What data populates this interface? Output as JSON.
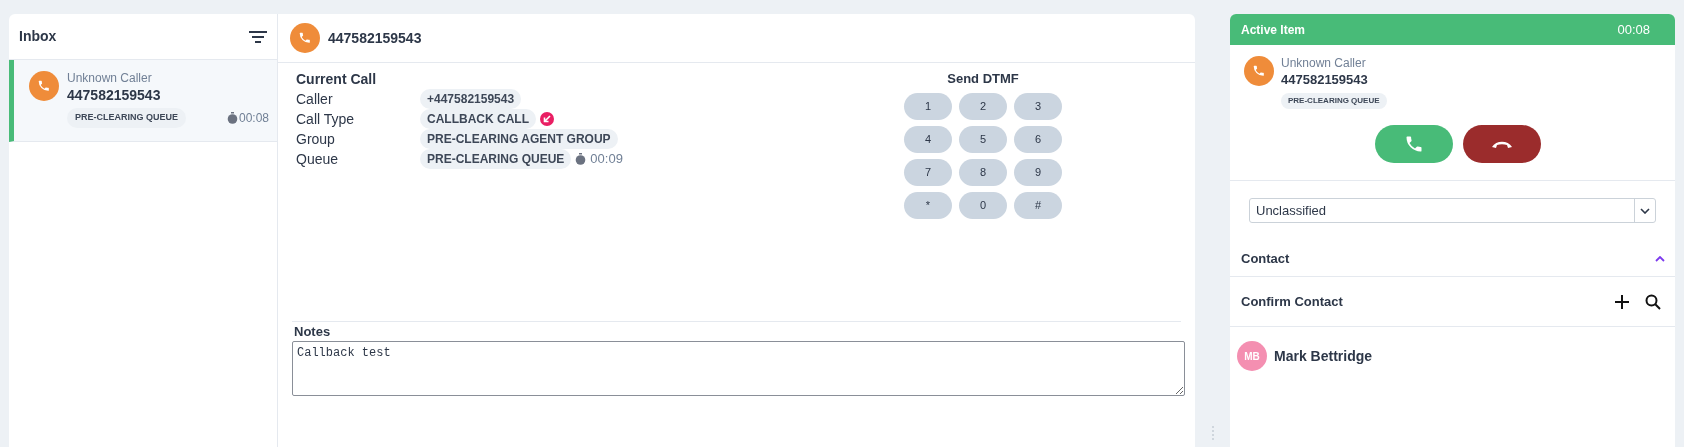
{
  "inbox": {
    "title": "Inbox",
    "items": [
      {
        "caller": "Unknown Caller",
        "number": "447582159543",
        "queue": "PRE-CLEARING QUEUE",
        "timer": "00:08",
        "selected": true
      }
    ]
  },
  "call": {
    "number": "447582159543",
    "section_title": "Current Call",
    "fields": [
      {
        "label": "Caller",
        "value": "+447582159543"
      },
      {
        "label": "Call Type",
        "value": "CALLBACK CALL",
        "kind": "callback"
      },
      {
        "label": "Group",
        "value": "PRE-CLEARING AGENT GROUP"
      },
      {
        "label": "Queue",
        "value": "PRE-CLEARING QUEUE",
        "kind": "timed",
        "timer": "00:09"
      }
    ],
    "dtmf": {
      "title": "Send DTMF",
      "keys": [
        "1",
        "2",
        "3",
        "4",
        "5",
        "6",
        "7",
        "8",
        "9",
        "*",
        "0",
        "#"
      ]
    },
    "notes": {
      "label": "Notes",
      "value": "Callback test"
    }
  },
  "active_item": {
    "title": "Active Item",
    "timer": "00:08",
    "caller": "Unknown Caller",
    "number": "447582159543",
    "queue": "PRE-CLEARING QUEUE",
    "classification": "Unclassified",
    "contact": {
      "title": "Contact",
      "expanded": true
    },
    "confirm_contact": {
      "title": "Confirm Contact",
      "contacts": [
        {
          "initials": "MB",
          "name": "Mark Bettridge",
          "color": "#f48fb1"
        }
      ]
    }
  }
}
